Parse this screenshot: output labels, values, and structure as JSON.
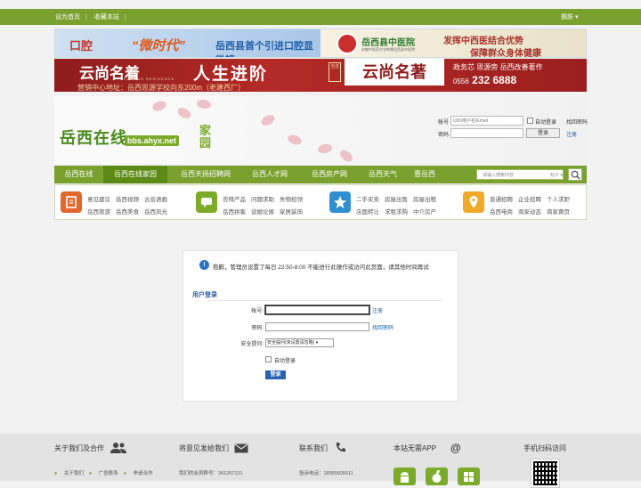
{
  "topbar": {
    "home_link": "设为首页",
    "favorite_link": "收藏本站",
    "skin_label": "换肤"
  },
  "banner1": {
    "left_prefix": "口腔",
    "left_highlight": "“微时代”",
    "left_text": "岳西县首个引进口腔显微镜",
    "hospital_name": "岳西县中医院",
    "hospital_sub": "安徽中医药大学附属岳西县中医院",
    "slogan_line1": "发挥中西医结合优势",
    "slogan_line2": "保障群众身体健康"
  },
  "banner2": {
    "brand": "云尚名着",
    "brand_en": "FAMOUS RESIDENCE",
    "slogan": "人生进阶",
    "tag": "当选",
    "highlight": "云尚名著",
    "address": "营销中心地址：岳西思源学校向东200m（老建西厂）",
    "names": "政务芯  思源旁  岳西改善著作",
    "tel_prefix": "0556",
    "tel_number": "232 6888"
  },
  "header": {
    "site_name": "岳西在线",
    "domain": "bbs.ahyx.net",
    "jia_yuan": "家园"
  },
  "login": {
    "account_label": "帐号",
    "account_placeholder": "UID/用户名/Email",
    "auto_login_label": "自动登录",
    "find_password": "找回密码",
    "password_label": "密码",
    "login_button": "登录",
    "register": "注册"
  },
  "nav": {
    "items": [
      "岳西在线",
      "岳西在线家园",
      "岳西天扬招聘网",
      "岳西人才网",
      "岳西房产网",
      "岳西天气",
      "惠岳西"
    ],
    "active_index": 1,
    "search_placeholder": "请输入搜索内容",
    "search_scope": "帖子"
  },
  "categories": [
    {
      "icon": "building-icon",
      "color": "#e2672a",
      "row1": [
        "意见建议",
        "岳西视频",
        "古岳语画"
      ],
      "row2": [
        "岳西旅游",
        "岳西美食",
        "岳西风光"
      ]
    },
    {
      "icon": "chat-icon",
      "color": "#7bab28",
      "row1": [
        "农特产品",
        "问题求助",
        "失物招领"
      ],
      "row2": [
        "岳西拼客",
        "谈婚论嫁",
        "家居装饰"
      ]
    },
    {
      "icon": "star-icon",
      "color": "#2f8fd1",
      "row1": [
        "二手买卖",
        "房屋出售",
        "房屋出租"
      ],
      "row2": [
        "店面转让",
        "求租求购",
        "中介房产"
      ]
    },
    {
      "icon": "location-icon",
      "color": "#f0a92a",
      "row1": [
        "普通招聘",
        "企业招聘",
        "个人求职"
      ],
      "row2": [
        "岳西电商",
        "商家动态",
        "商家黄页"
      ]
    }
  ],
  "main": {
    "notice": "抱歉，管理员设置了每日 22:50-8:00 不能进行此操作或访问此页面，请其他时间再试",
    "form_title": "用户登录",
    "account_label": "帐号:",
    "register_link": "注册",
    "password_label": "密码:",
    "find_password_link": "找回密码",
    "question_label": "安全提问:",
    "question_value": "安全提问(未设置请忽略)",
    "auto_login_label": "自动登录",
    "submit_label": "登录"
  },
  "footer": {
    "about": {
      "title": "关于我们及合作",
      "links": [
        "关于我们",
        "广告联系",
        "申请合作"
      ]
    },
    "feedback": {
      "title": "将意见发给我们",
      "text": "我们的会员群号：341257131"
    },
    "contact": {
      "title": "联系我们",
      "text": "投诉电话：18955605511"
    },
    "app": {
      "title": "本站无需APP",
      "icons": [
        "android-icon",
        "apple-icon",
        "windows-icon"
      ]
    },
    "qr": {
      "title": "手机扫码访问"
    }
  }
}
